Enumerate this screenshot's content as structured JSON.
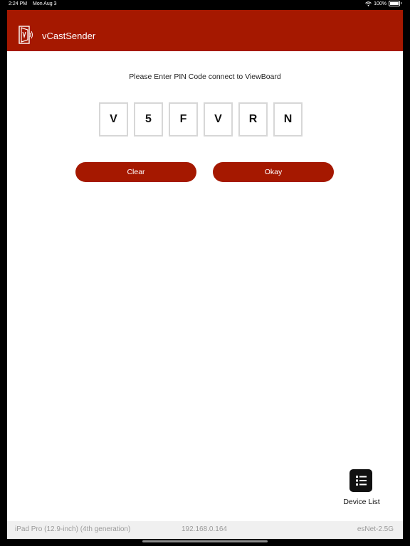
{
  "status_bar": {
    "time": "2:24 PM",
    "date": "Mon Aug 3",
    "battery": "100%",
    "icons": [
      "wifi-icon",
      "battery-icon"
    ]
  },
  "header": {
    "app_title": "vCastSender",
    "logo_icon": "vcast-logo-icon",
    "background_color": "#a51800"
  },
  "main": {
    "prompt": "Please Enter PIN Code connect to ViewBoard",
    "pin": [
      "V",
      "5",
      "F",
      "V",
      "R",
      "N"
    ],
    "clear_label": "Clear",
    "okay_label": "Okay",
    "accent_color": "#a51800"
  },
  "device_list": {
    "icon": "list-icon",
    "label": "Device List"
  },
  "footer": {
    "device": "iPad Pro (12.9-inch) (4th generation)",
    "ip": "192.168.0.164",
    "network": "esNet-2.5G"
  }
}
